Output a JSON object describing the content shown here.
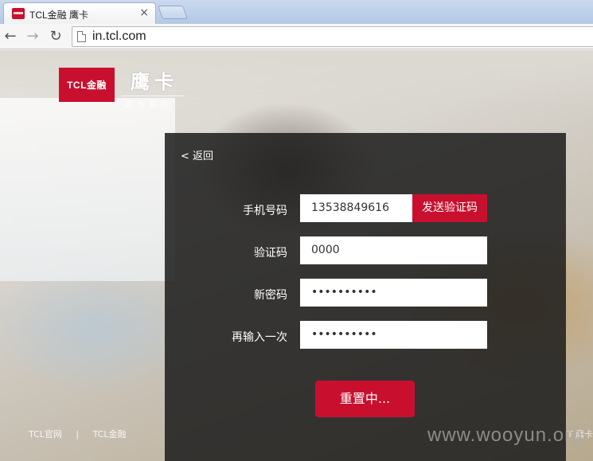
{
  "browser": {
    "tab_title": "TCL金融 鹰卡",
    "tab_close": "×",
    "url": "in.tcl.com",
    "back_glyph": "←",
    "forward_glyph": "→",
    "reload_glyph": "↻"
  },
  "header": {
    "logo_text": "TCL金融",
    "brand_name": "鹰卡",
    "slogan": "因为有你"
  },
  "form": {
    "back_label": "< 返回",
    "phone_label": "手机号码",
    "phone_value": "13538849616",
    "send_code_label": "发送验证码",
    "code_label": "验证码",
    "code_value": "0000",
    "new_password_label": "新密码",
    "new_password_value": "••••••••••",
    "confirm_password_label": "再输入一次",
    "confirm_password_value": "••••••••••",
    "submit_label": "重置中..."
  },
  "footer": {
    "link1": "TCL官网",
    "separator": "|",
    "link2": "TCL金融",
    "right_text": "T 鹰卡"
  },
  "watermark": "www.wooyun.org",
  "colors": {
    "brand_red": "#c8102e",
    "panel": "#1c1c1c"
  }
}
